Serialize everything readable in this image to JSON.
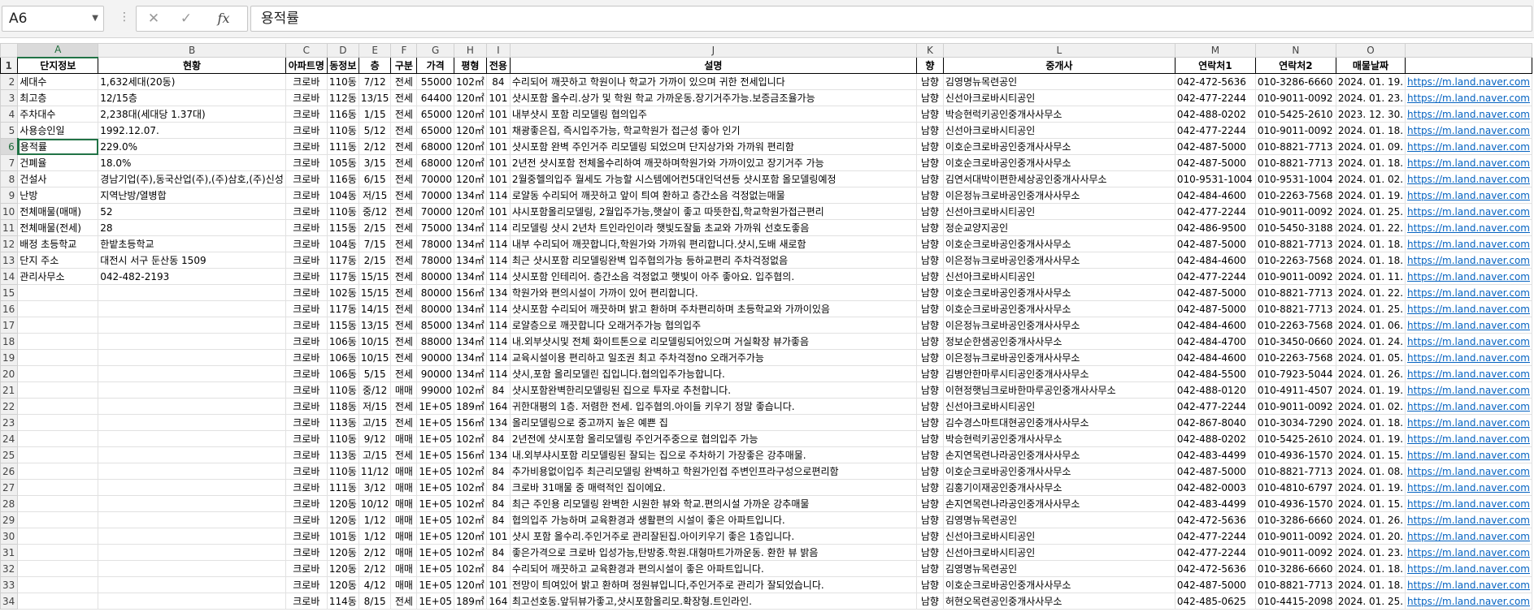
{
  "name_box": "A6",
  "formula": "용적률",
  "columns": [
    "A",
    "B",
    "C",
    "D",
    "E",
    "F",
    "G",
    "H",
    "I",
    "J",
    "K",
    "L",
    "M",
    "N",
    "O",
    ""
  ],
  "selected_column": "A",
  "selected_row": "6",
  "header_row": [
    "단지정보",
    "현황",
    "아파트명",
    "동정보",
    "층",
    "구분",
    "가격",
    "평형",
    "전용",
    "설명",
    "향",
    "중개사",
    "연락처1",
    "연락처2",
    "매물날짜",
    ""
  ],
  "rows": [
    [
      "2",
      "세대수",
      "1,632세대(20동)",
      "크로바",
      "110동",
      "7/12",
      "전세",
      "55000",
      "102㎡",
      "84",
      "수리되어 깨끗하고 학원이나 학교가 가까이 있으며 귀한 전세입니다",
      "남향",
      "김영명뉴목련공인",
      "042-472-5636",
      "010-3286-6660",
      "2024. 01. 19.",
      "https://m.land.naver.com"
    ],
    [
      "3",
      "최고층",
      "12/15층",
      "크로바",
      "112동",
      "13/15",
      "전세",
      "64400",
      "120㎡",
      "101",
      "샷시포함 올수리.상가 및 학원 학교 가까운동.장기거주가능.보증금조율가능",
      "남향",
      "신선아크로바시티공인",
      "042-477-2244",
      "010-9011-0092",
      "2024. 01. 23.",
      "https://m.land.naver.com"
    ],
    [
      "4",
      "주차대수",
      "2,238대(세대당 1.37대)",
      "크로바",
      "116동",
      "1/15",
      "전세",
      "65000",
      "120㎡",
      "101",
      "내부샷시 포함 리모델링 협의입주",
      "남향",
      "박승현럭키공인중개사사무소",
      "042-488-0202",
      "010-5425-2610",
      "2023. 12. 30.",
      "https://m.land.naver.com"
    ],
    [
      "5",
      "사용승인일",
      "1992.12.07.",
      "크로바",
      "110동",
      "5/12",
      "전세",
      "65000",
      "120㎡",
      "101",
      "채광좋은집, 즉시입주가능, 학교학원가 접근성 좋아 인기",
      "남향",
      "신선아크로바시티공인",
      "042-477-2244",
      "010-9011-0092",
      "2024. 01. 18.",
      "https://m.land.naver.com"
    ],
    [
      "6",
      "용적률",
      "229.0%",
      "크로바",
      "111동",
      "2/12",
      "전세",
      "68000",
      "120㎡",
      "101",
      "샷시포함 완벽 주인거주 리모델링 되었으며 단지상가와 가까워 편리함",
      "남향",
      "이호순크로바공인중개사사무소",
      "042-487-5000",
      "010-8821-7713",
      "2024. 01. 09.",
      "https://m.land.naver.com"
    ],
    [
      "7",
      "건폐율",
      "18.0%",
      "크로바",
      "105동",
      "3/15",
      "전세",
      "68000",
      "120㎡",
      "101",
      "2년전 샷시포함 전체올수리하여 깨끗하며학원가와  가까이있고 장기거주 가능",
      "남향",
      "이호순크로바공인중개사사무소",
      "042-487-5000",
      "010-8821-7713",
      "2024. 01. 18.",
      "https://m.land.naver.com"
    ],
    [
      "8",
      "건설사",
      "경남기업(주),동국산업(주),(주)삼호,(주)신성",
      "크로바",
      "116동",
      "6/15",
      "전세",
      "70000",
      "120㎡",
      "101",
      "2월중헬의입주 월세도 가능할 시스템에어컨5대인덕션등 샷시포함 올모델링예정",
      "남향",
      "김연서대박이편한세상공인중개사사무소",
      "010-9531-1004",
      "010-9531-1004",
      "2024. 01. 02.",
      "https://m.land.naver.com"
    ],
    [
      "9",
      "난방",
      "지역난방/열병합",
      "크로바",
      "104동",
      "저/15",
      "전세",
      "70000",
      "134㎡",
      "114",
      "로얄동   수리되어 깨끗하고 앞이 틔여 환하고 층간소음 걱정없는매물",
      "남향",
      "이은정뉴크로바공인중개사사무소",
      "042-484-4600",
      "010-2263-7568",
      "2024. 01. 19.",
      "https://m.land.naver.com"
    ],
    [
      "10",
      "전체매물(매매)",
      "52",
      "크로바",
      "110동",
      "중/12",
      "전세",
      "70000",
      "120㎡",
      "101",
      "샤시포함올리모델링, 2월입주가능,햇살이 좋고 따뜻한집,학교학원가접근편리",
      "남향",
      "신선아크로바시티공인",
      "042-477-2244",
      "010-9011-0092",
      "2024. 01. 25.",
      "https://m.land.naver.com"
    ],
    [
      "11",
      "전체매물(전세)",
      "28",
      "크로바",
      "115동",
      "2/15",
      "전세",
      "75000",
      "134㎡",
      "114",
      "리모델링 샷시 2년차 트인라인이라 햇빛도잘듦 초교와 가까워 선호도좋음",
      "남향",
      "정순교양지공인",
      "042-486-9500",
      "010-5450-3188",
      "2024. 01. 22.",
      "https://m.land.naver.com"
    ],
    [
      "12",
      "배정 초등학교",
      "한밭초등학교",
      "크로바",
      "104동",
      "7/15",
      "전세",
      "78000",
      "134㎡",
      "114",
      "내부 수리되어 깨끗합니다,학원가와 가까워 편리합니다.샷시,도배 새로함",
      "남향",
      "이호순크로바공인중개사사무소",
      "042-487-5000",
      "010-8821-7713",
      "2024. 01. 18.",
      "https://m.land.naver.com"
    ],
    [
      "13",
      "단지 주소",
      "대전시 서구 둔산동 1509",
      "크로바",
      "117동",
      "2/15",
      "전세",
      "78000",
      "134㎡",
      "114",
      "최근 샷시포함 리모델링완벽  입주협의가능 등하교편리 주차걱정없음",
      "남향",
      "이은정뉴크로바공인중개사사무소",
      "042-484-4600",
      "010-2263-7568",
      "2024. 01. 18.",
      "https://m.land.naver.com"
    ],
    [
      "14",
      "관리사무소",
      "042-482-2193",
      "크로바",
      "117동",
      "15/15",
      "전세",
      "80000",
      "134㎡",
      "114",
      "샷시포함 인테리어. 층간소음 걱정없고 햇빛이 아주 좋아요. 입주협의.",
      "남향",
      "신선아크로바시티공인",
      "042-477-2244",
      "010-9011-0092",
      "2024. 01. 11.",
      "https://m.land.naver.com"
    ],
    [
      "15",
      "",
      "",
      "크로바",
      "102동",
      "15/15",
      "전세",
      "80000",
      "156㎡",
      "134",
      "학원가와 편의시설이 가까이 있어 편리합니다.",
      "남향",
      "이호순크로바공인중개사사무소",
      "042-487-5000",
      "010-8821-7713",
      "2024. 01. 22.",
      "https://m.land.naver.com"
    ],
    [
      "16",
      "",
      "",
      "크로바",
      "117동",
      "14/15",
      "전세",
      "80000",
      "134㎡",
      "114",
      "샷시포함 수리되어 깨끗하며 밝고 환하며 주차편리하며 초등학교와 가까이있음",
      "남향",
      "이호순크로바공인중개사사무소",
      "042-487-5000",
      "010-8821-7713",
      "2024. 01. 25.",
      "https://m.land.naver.com"
    ],
    [
      "17",
      "",
      "",
      "크로바",
      "115동",
      "13/15",
      "전세",
      "85000",
      "134㎡",
      "114",
      "로얄층으로  깨끗합니다  오래거주가능 협의입주",
      "남향",
      "이은정뉴크로바공인중개사사무소",
      "042-484-4600",
      "010-2263-7568",
      "2024. 01. 06.",
      "https://m.land.naver.com"
    ],
    [
      "18",
      "",
      "",
      "크로바",
      "106동",
      "10/15",
      "전세",
      "88000",
      "134㎡",
      "114",
      "내.외부샷시및 전체 화이트톤으로 리모델링되어있으며 거실확장 뷰가좋음",
      "남향",
      "정보순한샘공인중개사사무소",
      "042-484-4700",
      "010-3450-0660",
      "2024. 01. 24.",
      "https://m.land.naver.com"
    ],
    [
      "19",
      "",
      "",
      "크로바",
      "106동",
      "10/15",
      "전세",
      "90000",
      "134㎡",
      "114",
      "교육시설이용 편리하고 일조권 최고 주차걱정no 오래거주가능",
      "남향",
      "이은정뉴크로바공인중개사사무소",
      "042-484-4600",
      "010-2263-7568",
      "2024. 01. 05.",
      "https://m.land.naver.com"
    ],
    [
      "20",
      "",
      "",
      "크로바",
      "106동",
      "5/15",
      "전세",
      "90000",
      "134㎡",
      "114",
      "샷시,포함 올리모델린 집입니다.협의입주가능합니다.",
      "남향",
      "김병안한마루시티공인중개사사무소",
      "042-484-5500",
      "010-7923-5044",
      "2024. 01. 26.",
      "https://m.land.naver.com"
    ],
    [
      "21",
      "",
      "",
      "크로바",
      "110동",
      "중/12",
      "매매",
      "99000",
      "102㎡",
      "84",
      "샷시포함완벽한리모델링된 집으로 투자로 추천합니다.",
      "남향",
      "이현정햇님크로바한마루공인중개사사무소",
      "042-488-0120",
      "010-4911-4507",
      "2024. 01. 19.",
      "https://m.land.naver.com"
    ],
    [
      "22",
      "",
      "",
      "크로바",
      "118동",
      "저/15",
      "전세",
      "1E+05",
      "189㎡",
      "164",
      "귀한대평의 1층. 저렴한 전세. 입주협의.아이들 키우기 정말 좋습니다.",
      "남향",
      "신선아크로바시티공인",
      "042-477-2244",
      "010-9011-0092",
      "2024. 01. 02.",
      "https://m.land.naver.com"
    ],
    [
      "23",
      "",
      "",
      "크로바",
      "113동",
      "고/15",
      "전세",
      "1E+05",
      "156㎡",
      "134",
      "올리모델링으로 중고까지 높은 예쁜 집",
      "남향",
      "김수경스마트대현공인중개사사무소",
      "042-867-8040",
      "010-3034-7290",
      "2024. 01. 18.",
      "https://m.land.naver.com"
    ],
    [
      "24",
      "",
      "",
      "크로바",
      "110동",
      "9/12",
      "매매",
      "1E+05",
      "102㎡",
      "84",
      "2년전에 샷시포함 올리모델링  주인거주중으로  협의입주 가능",
      "남향",
      "박승현럭키공인중개사사무소",
      "042-488-0202",
      "010-5425-2610",
      "2024. 01. 19.",
      "https://m.land.naver.com"
    ],
    [
      "25",
      "",
      "",
      "크로바",
      "113동",
      "고/15",
      "전세",
      "1E+05",
      "156㎡",
      "134",
      "내.외부샤시포함 리모델링된 잘되는 집으로 주차하기 가장좋은 강추매물.",
      "남향",
      "손지연목련나라공인중개사사무소",
      "042-483-4499",
      "010-4936-1570",
      "2024. 01. 15.",
      "https://m.land.naver.com"
    ],
    [
      "26",
      "",
      "",
      "크로바",
      "110동",
      "11/12",
      "매매",
      "1E+05",
      "102㎡",
      "84",
      "추가비용없이입주 최근리모델링 완벽하고 학원가인접 주변인프라구성으로편리함",
      "남향",
      "이호순크로바공인중개사사무소",
      "042-487-5000",
      "010-8821-7713",
      "2024. 01. 08.",
      "https://m.land.naver.com"
    ],
    [
      "27",
      "",
      "",
      "크로바",
      "111동",
      "3/12",
      "매매",
      "1E+05",
      "102㎡",
      "84",
      "크로바 31매물 중 매력적인 집이에요.",
      "남향",
      "김홍기이재공인중개사사무소",
      "042-482-0003",
      "010-4810-6797",
      "2024. 01. 19.",
      "https://m.land.naver.com"
    ],
    [
      "28",
      "",
      "",
      "크로바",
      "120동",
      "10/12",
      "매매",
      "1E+05",
      "102㎡",
      "84",
      "최근 주인용 리모델링 완벽한 시원한 뷰와 학교.편의시설 가까운 강추매물",
      "남향",
      "손지연목련나라공인중개사사무소",
      "042-483-4499",
      "010-4936-1570",
      "2024. 01. 15.",
      "https://m.land.naver.com"
    ],
    [
      "29",
      "",
      "",
      "크로바",
      "120동",
      "1/12",
      "매매",
      "1E+05",
      "102㎡",
      "84",
      "협의입주 가능하며 교육환경과 생활편의 시설이 좋은 아파트입니다.",
      "남향",
      "김영명뉴목련공인",
      "042-472-5636",
      "010-3286-6660",
      "2024. 01. 26.",
      "https://m.land.naver.com"
    ],
    [
      "30",
      "",
      "",
      "크로바",
      "101동",
      "1/12",
      "매매",
      "1E+05",
      "120㎡",
      "101",
      "샷시 포함 올수리.주인거주로 관리잘된집.아이키우기 좋은 1층입니다.",
      "남향",
      "신선아크로바시티공인",
      "042-477-2244",
      "010-9011-0092",
      "2024. 01. 20.",
      "https://m.land.naver.com"
    ],
    [
      "31",
      "",
      "",
      "크로바",
      "120동",
      "2/12",
      "매매",
      "1E+05",
      "102㎡",
      "84",
      "좋은가격으로 크로바 입성가능,탄방중.학원.대형마트가까운동. 환한 뷰 밝음",
      "남향",
      "신선아크로바시티공인",
      "042-477-2244",
      "010-9011-0092",
      "2024. 01. 23.",
      "https://m.land.naver.com"
    ],
    [
      "32",
      "",
      "",
      "크로바",
      "120동",
      "2/12",
      "매매",
      "1E+05",
      "102㎡",
      "84",
      "수리되어 깨끗하고 교육환경과 편의시설이 좋은 아파트입니다.",
      "남향",
      "김영명뉴목련공인",
      "042-472-5636",
      "010-3286-6660",
      "2024. 01. 18.",
      "https://m.land.naver.com"
    ],
    [
      "33",
      "",
      "",
      "크로바",
      "120동",
      "4/12",
      "매매",
      "1E+05",
      "120㎡",
      "101",
      "전망이 틔여있어 밝고 환하며 정원뷰입니다,주인거주로 관리가 잘되었습니다.",
      "남향",
      "이호순크로바공인중개사사무소",
      "042-487-5000",
      "010-8821-7713",
      "2024. 01. 18.",
      "https://m.land.naver.com"
    ],
    [
      "34",
      "",
      "",
      "크로바",
      "114동",
      "8/15",
      "전세",
      "1E+05",
      "189㎡",
      "164",
      "최고선호동.앞뒤뷰가좋고,샷시포함올리모.확장형.트인라인.",
      "남향",
      "허현오목련공인중개사사무소",
      "042-485-0625",
      "010-4415-2098",
      "2024. 01. 25.",
      "https://m.land.naver.com"
    ]
  ]
}
